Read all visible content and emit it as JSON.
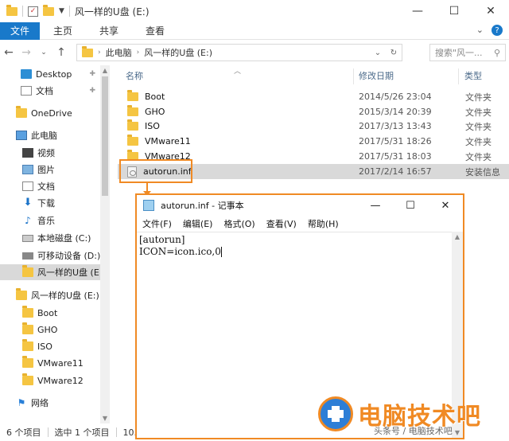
{
  "window": {
    "title": "风一样的U盘 (E:)",
    "controls": {
      "minimize": "—",
      "maximize": "☐",
      "close": "✕"
    }
  },
  "ribbon": {
    "file_tab": "文件",
    "tabs": [
      "主页",
      "共享",
      "查看"
    ]
  },
  "address": {
    "crumbs": [
      "此电脑",
      "风一样的U盘 (E:)"
    ],
    "search_placeholder": "搜索\"风一..."
  },
  "sidebar": {
    "items": [
      {
        "label": "Desktop",
        "icon": "desktop-icon",
        "pinned": true
      },
      {
        "label": "文档",
        "icon": "document-icon",
        "pinned": true
      },
      {
        "label": "OneDrive",
        "icon": "folder-icon"
      },
      {
        "label": "此电脑",
        "icon": "computer-icon"
      },
      {
        "label": "视频",
        "icon": "video-icon"
      },
      {
        "label": "图片",
        "icon": "picture-icon"
      },
      {
        "label": "文档",
        "icon": "document-icon"
      },
      {
        "label": "下载",
        "icon": "download-icon"
      },
      {
        "label": "音乐",
        "icon": "music-icon"
      },
      {
        "label": "本地磁盘 (C:)",
        "icon": "disk-icon"
      },
      {
        "label": "可移动设备 (D:)",
        "icon": "usb-icon"
      },
      {
        "label": "风一样的U盘 (E:",
        "icon": "folder-icon",
        "active": true
      },
      {
        "label": "风一样的U盘 (E:)",
        "icon": "folder-icon"
      },
      {
        "label": "Boot",
        "icon": "folder-icon"
      },
      {
        "label": "GHO",
        "icon": "folder-icon"
      },
      {
        "label": "ISO",
        "icon": "folder-icon"
      },
      {
        "label": "VMware11",
        "icon": "folder-icon"
      },
      {
        "label": "VMware12",
        "icon": "folder-icon"
      },
      {
        "label": "网络",
        "icon": "network-icon"
      }
    ]
  },
  "filelist": {
    "columns": {
      "name": "名称",
      "date": "修改日期",
      "type": "类型"
    },
    "rows": [
      {
        "name": "Boot",
        "date": "2014/5/26 23:04",
        "type": "文件夹"
      },
      {
        "name": "GHO",
        "date": "2015/3/14 20:39",
        "type": "文件夹"
      },
      {
        "name": "ISO",
        "date": "2017/3/13 13:43",
        "type": "文件夹"
      },
      {
        "name": "VMware11",
        "date": "2017/5/31 18:26",
        "type": "文件夹"
      },
      {
        "name": "VMware12",
        "date": "2017/5/31 18:03",
        "type": "文件夹"
      },
      {
        "name": "autorun.inf",
        "date": "2017/2/14 16:57",
        "type": "安装信息"
      }
    ]
  },
  "status": {
    "count": "6 个项目",
    "selected": "选中 1 个项目",
    "size": "10.1"
  },
  "notepad": {
    "title": "autorun.inf - 记事本",
    "menu": [
      "文件(F)",
      "编辑(E)",
      "格式(O)",
      "查看(V)",
      "帮助(H)"
    ],
    "lines": [
      "[autorun]",
      "ICON=icon.ico,0"
    ]
  },
  "watermark": {
    "brand": "电脑技术吧",
    "sub": "头条号 / 电脑技术吧"
  },
  "colors": {
    "accent_blue": "#1979ca",
    "highlight_orange": "#f08a24",
    "folder_yellow": "#f5c542"
  }
}
